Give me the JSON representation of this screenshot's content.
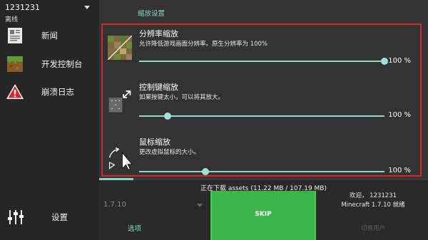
{
  "account": {
    "name": "1231231",
    "status": "离线"
  },
  "nav": [
    {
      "label": "新闻",
      "icon": "newspaper-icon"
    },
    {
      "label": "开发控制台",
      "icon": "grass-block-icon"
    },
    {
      "label": "崩溃日志",
      "icon": "warning-icon"
    }
  ],
  "settings_nav": {
    "label": "设置",
    "icon": "sliders-icon"
  },
  "section_title": "缩放设置",
  "rows": [
    {
      "title": "分辨率缩放",
      "desc": "允许降低游戏画面分辨率。原生分辨率为 100%",
      "value": "100 %",
      "level": 1.0
    },
    {
      "title": "控制键缩放",
      "desc": "如果按键太小，可以将其放大。",
      "value": "100 %",
      "level": 0.12
    },
    {
      "title": "鼠标缩放",
      "desc": "更改虚拟鼠标的大小。",
      "value": "100 %",
      "level": 0.28
    }
  ],
  "download_status": "正在下载 assets (11.22 MB / 107.19 MB)",
  "download_progress": 0.1047,
  "version": "1.7.10",
  "options_label": "选项",
  "skip_label": "SKIP",
  "welcome_line1": "欢迎，  1231231",
  "welcome_line2": "Minecraft 1.7.10 就绪",
  "switch_user_label": "切换用户",
  "colors": {
    "accent": "#7fd8c8",
    "highlight_border": "#d9262a",
    "skip_green": "#3bb54a"
  }
}
